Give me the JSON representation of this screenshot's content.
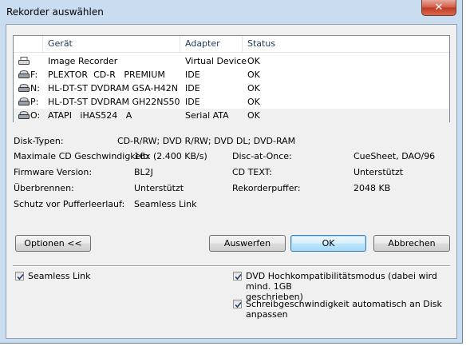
{
  "window": {
    "title": "Rekorder auswählen",
    "close_glyph": "✕"
  },
  "device_list": {
    "columns": [
      "Gerät",
      "Adapter",
      "Status"
    ],
    "rows": [
      {
        "letter": "",
        "name": "Image Recorder",
        "adapter": "Virtual Device",
        "status": "OK",
        "icon": "image-recorder-icon"
      },
      {
        "letter": "F:",
        "name": "PLEXTOR  CD-R   PREMIUM",
        "adapter": "IDE",
        "status": "OK",
        "icon": "drive-icon"
      },
      {
        "letter": "N:",
        "name": "HL-DT-ST DVDRAM GSA-H42N",
        "adapter": "IDE",
        "status": "OK",
        "icon": "drive-icon"
      },
      {
        "letter": "P:",
        "name": "HL-DT-ST DVDRAM GH22NS50",
        "adapter": "IDE",
        "status": "OK",
        "icon": "drive-icon"
      },
      {
        "letter": "O:",
        "name": "ATAPI   iHAS524   A",
        "adapter": "Serial ATA",
        "status": "OK",
        "icon": "drive-icon"
      }
    ]
  },
  "info": {
    "disk_types_label": "Disk-Typen:",
    "disk_types_value": "CD-R/RW; DVD R/RW; DVD DL; DVD-RAM",
    "max_speed_label": "Maximale CD Geschwindigkeit:",
    "max_speed_value": "16x (2.400 KB/s)",
    "firmware_label": "Firmware Version:",
    "firmware_value": "BL2J",
    "overburn_label": "Überbrennen:",
    "overburn_value": "Unterstützt",
    "buffer_protection_label": "Schutz vor Pufferleerlauf:",
    "buffer_protection_value": "Seamless Link",
    "dao_label": "Disc-at-Once:",
    "dao_value": "CueSheet, DAO/96",
    "cdtext_label": "CD TEXT:",
    "cdtext_value": "Unterstützt",
    "recorder_buffer_label": "Rekorderpuffer:",
    "recorder_buffer_value": "2048 KB"
  },
  "buttons": {
    "options": "Optionen <<",
    "eject": "Auswerfen",
    "ok": "OK",
    "cancel": "Abbrechen"
  },
  "options": {
    "seamless_link": {
      "label": "Seamless Link",
      "checked": true
    },
    "dvd_compat": {
      "label_line1": "DVD Hochkompatibilitätsmodus (dabei wird mind. 1GB",
      "label_line2": "geschrieben)",
      "checked": true
    },
    "auto_speed": {
      "label_line1": "Schreibgeschwindigkeit automatisch an Disk",
      "label_line2": "anpassen",
      "checked": true
    }
  }
}
